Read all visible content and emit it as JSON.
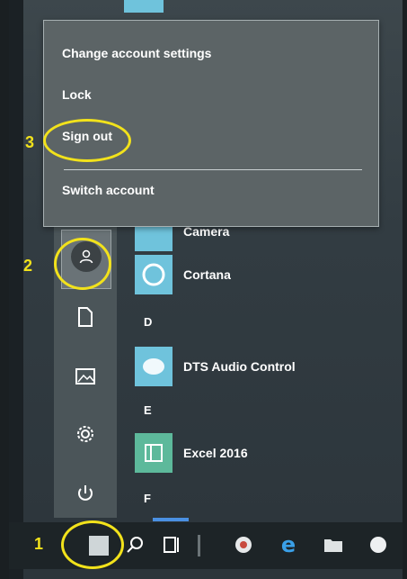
{
  "account_menu": {
    "items": [
      "Change account settings",
      "Lock",
      "Sign out"
    ],
    "switch_label": "Switch account"
  },
  "apps": {
    "camera": "Camera",
    "cortana": "Cortana",
    "letter_d": "D",
    "dts": "DTS Audio Control",
    "letter_e": "E",
    "excel": "Excel 2016",
    "letter_f": "F"
  },
  "annotations": {
    "step1": "1",
    "step2": "2",
    "step3": "3",
    "color": "#f2e21b"
  },
  "icons": {
    "rail": [
      "user-avatar-icon",
      "documents-icon",
      "pictures-icon",
      "settings-gear-icon",
      "power-icon"
    ],
    "taskbar": [
      "windows-start-icon",
      "search-icon",
      "task-view-icon",
      "chrome-icon",
      "edge-icon",
      "file-explorer-icon",
      "browser-icon"
    ]
  },
  "colors": {
    "tile_blue": "#6fc3dc",
    "tile_green": "#5db99b",
    "highlight": "#f2e21b"
  }
}
